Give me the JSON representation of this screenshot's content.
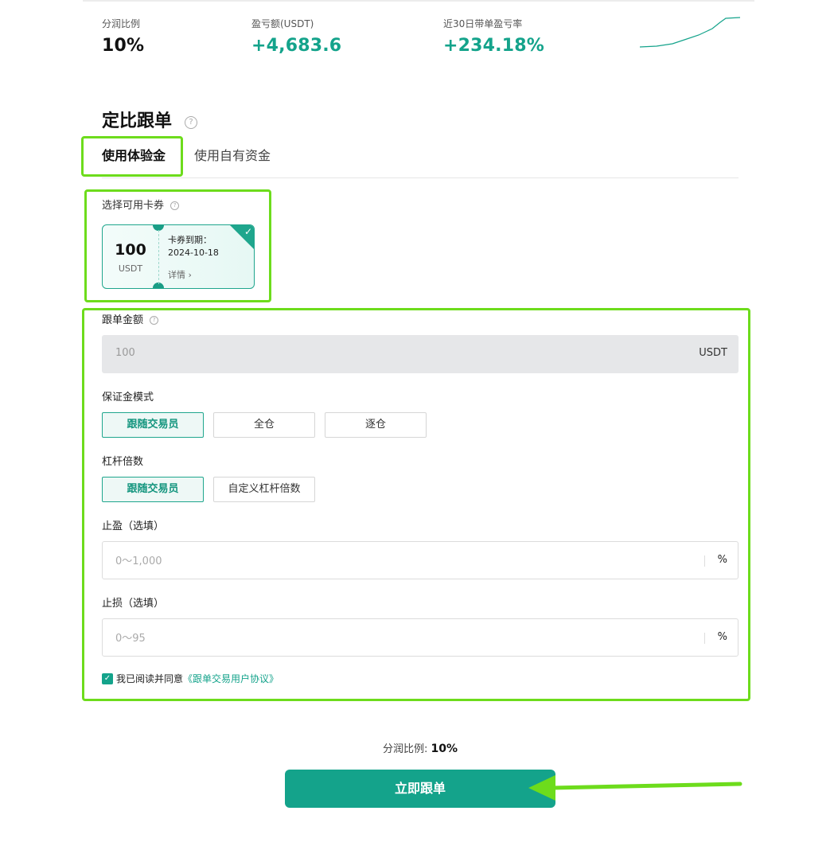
{
  "stats": [
    {
      "label": "分润比例",
      "value": "10%",
      "tone": "dark"
    },
    {
      "label": "盈亏额(USDT)",
      "value": "+4,683.6",
      "tone": "green"
    },
    {
      "label": "近30日带单盈亏率",
      "value": "+234.18%",
      "tone": "green"
    }
  ],
  "section": {
    "title": "定比跟单",
    "help_glyph": "?"
  },
  "tabs": [
    {
      "label": "使用体验金",
      "active": true
    },
    {
      "label": "使用自有资金",
      "active": false
    }
  ],
  "coupon": {
    "label": "选择可用卡券",
    "amount": "100",
    "unit": "USDT",
    "expiry_label": "卡券到期：",
    "expiry_date": "2024-10-18",
    "detail": "详情 ›",
    "check_glyph": "✓"
  },
  "form": {
    "amount_label": "跟单金额",
    "amount_value": "100",
    "amount_unit": "USDT",
    "margin_label": "保证金模式",
    "margin_options": [
      "跟随交易员",
      "全仓",
      "逐仓"
    ],
    "margin_selected": "跟随交易员",
    "leverage_label": "杠杆倍数",
    "leverage_options": [
      "跟随交易员",
      "自定义杠杆倍数"
    ],
    "leverage_selected": "跟随交易员",
    "take_profit_label": "止盈（选填）",
    "take_profit_placeholder": "0～1,000",
    "stop_loss_label": "止损（选填）",
    "stop_loss_placeholder": "0～95",
    "percent_unit": "%"
  },
  "agreement": {
    "checked": true,
    "text": "我已阅读并同意",
    "link": "《跟单交易用户协议》",
    "check_glyph": "✓"
  },
  "profit_share": {
    "label": "分润比例:",
    "value": "10%"
  },
  "submit_label": "立即跟单",
  "colors": {
    "accent": "#14a38b",
    "annotation": "#6ddc1c"
  },
  "icons": {
    "help": "help-circle-icon",
    "check": "check-icon",
    "chevron": "chevron-right-icon",
    "arrow": "annotation-arrow"
  }
}
